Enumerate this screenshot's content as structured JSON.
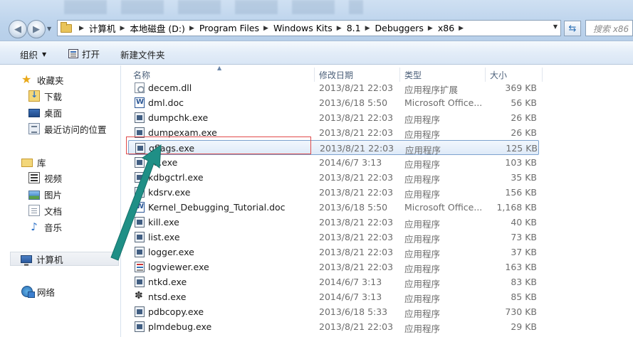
{
  "address": {
    "breadcrumbs": [
      "计算机",
      "本地磁盘 (D:)",
      "Program Files",
      "Windows Kits",
      "8.1",
      "Debuggers",
      "x86"
    ],
    "search_placeholder": "搜索 x86"
  },
  "toolbar": {
    "organize_label": "组织",
    "open_label": "打开",
    "new_folder_label": "新建文件夹"
  },
  "nav": {
    "favorites": {
      "label": "收藏夹",
      "items": [
        "下载",
        "桌面",
        "最近访问的位置"
      ]
    },
    "libraries": {
      "label": "库",
      "items": [
        "视频",
        "图片",
        "文档",
        "音乐"
      ]
    },
    "computer_label": "计算机",
    "network_label": "网络"
  },
  "file_list": {
    "columns": [
      "名称",
      "修改日期",
      "类型",
      "大小"
    ],
    "rows": [
      {
        "name": "decem.dll",
        "date": "2013/8/21 22:03",
        "type": "应用程序扩展",
        "size": "369 KB",
        "icon": "dll-icon"
      },
      {
        "name": "dml.doc",
        "date": "2013/6/18 5:50",
        "type": "Microsoft Office...",
        "size": "56 KB",
        "icon": "word-doc-icon"
      },
      {
        "name": "dumpchk.exe",
        "date": "2013/8/21 22:03",
        "type": "应用程序",
        "size": "26 KB",
        "icon": "exe-icon"
      },
      {
        "name": "dumpexam.exe",
        "date": "2013/8/21 22:03",
        "type": "应用程序",
        "size": "26 KB",
        "icon": "exe-icon"
      },
      {
        "name": "gflags.exe",
        "date": "2013/8/21 22:03",
        "type": "应用程序",
        "size": "125 KB",
        "icon": "exe-icon"
      },
      {
        "name": "kd.exe",
        "date": "2014/6/7 3:13",
        "type": "应用程序",
        "size": "103 KB",
        "icon": "exe-icon"
      },
      {
        "name": "kdbgctrl.exe",
        "date": "2013/8/21 22:03",
        "type": "应用程序",
        "size": "35 KB",
        "icon": "exe-icon"
      },
      {
        "name": "kdsrv.exe",
        "date": "2013/8/21 22:03",
        "type": "应用程序",
        "size": "156 KB",
        "icon": "exe-icon"
      },
      {
        "name": "Kernel_Debugging_Tutorial.doc",
        "date": "2013/6/18 5:50",
        "type": "Microsoft Office...",
        "size": "1,168 KB",
        "icon": "word-doc-icon"
      },
      {
        "name": "kill.exe",
        "date": "2013/8/21 22:03",
        "type": "应用程序",
        "size": "40 KB",
        "icon": "exe-icon"
      },
      {
        "name": "list.exe",
        "date": "2013/8/21 22:03",
        "type": "应用程序",
        "size": "73 KB",
        "icon": "exe-icon"
      },
      {
        "name": "logger.exe",
        "date": "2013/8/21 22:03",
        "type": "应用程序",
        "size": "37 KB",
        "icon": "exe-icon"
      },
      {
        "name": "logviewer.exe",
        "date": "2013/8/21 22:03",
        "type": "应用程序",
        "size": "163 KB",
        "icon": "logviewer-icon"
      },
      {
        "name": "ntkd.exe",
        "date": "2014/6/7 3:13",
        "type": "应用程序",
        "size": "83 KB",
        "icon": "exe-icon"
      },
      {
        "name": "ntsd.exe",
        "date": "2014/6/7 3:13",
        "type": "应用程序",
        "size": "85 KB",
        "icon": "ntsd-icon"
      },
      {
        "name": "pdbcopy.exe",
        "date": "2013/6/18 5:33",
        "type": "应用程序",
        "size": "730 KB",
        "icon": "exe-icon"
      },
      {
        "name": "plmdebug.exe",
        "date": "2013/8/21 22:03",
        "type": "应用程序",
        "size": "29 KB",
        "icon": "exe-icon"
      }
    ],
    "selected_index": 4
  },
  "colors": {
    "selection_border": "#7da2ce",
    "highlight_annotation": "#e04a4a",
    "arrow_annotation": "#1f8f86"
  }
}
